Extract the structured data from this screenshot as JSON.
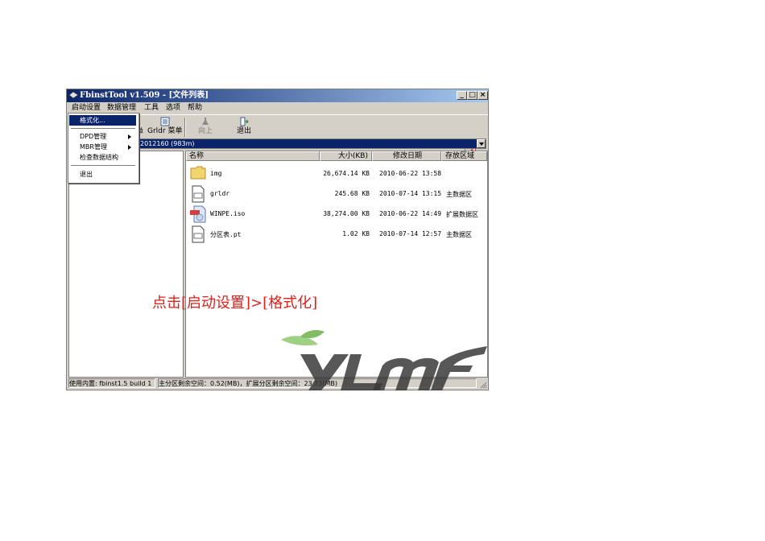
{
  "window": {
    "title": "FbinstTool v1.509 - [文件列表]",
    "controls": {
      "minimize": "_",
      "maximize": "□",
      "close": "×"
    }
  },
  "menubar": [
    "启动设置",
    "数据管理",
    "工具",
    "选项",
    "帮助"
  ],
  "toolbar": {
    "partial_label": "单",
    "grldr_menu": "Grldr 菜单",
    "up": "向上",
    "exit": "退出",
    "step_marker": "②"
  },
  "drive_selector": {
    "value": "2012160 (983m)"
  },
  "dropdown_menu": {
    "items": [
      {
        "label": "格式化...",
        "selected": true
      },
      {
        "label": "DPD管理",
        "submenu": true
      },
      {
        "label": "MBR管理",
        "submenu": true
      },
      {
        "label": "检查数据结构"
      },
      {
        "label": "退出"
      }
    ]
  },
  "file_list": {
    "columns": [
      "名称",
      "大小(KB)",
      "修改日期",
      "存放区域"
    ],
    "rows": [
      {
        "icon": "folder-icon",
        "name": "img",
        "size": "26,674.14 KB",
        "date": "2010-06-22 13:58",
        "area": ""
      },
      {
        "icon": "file-icon",
        "name": "grldr",
        "size": "245.68 KB",
        "date": "2010-07-14 13:15",
        "area": "主数据区"
      },
      {
        "icon": "iso-icon",
        "name": "WINPE.iso",
        "size": "38,274.00 KB",
        "date": "2010-06-22 14:49",
        "area": "扩展数据区"
      },
      {
        "icon": "file-icon",
        "name": "分区表.pt",
        "size": "1.02 KB",
        "date": "2010-07-14 12:57",
        "area": "主数据区"
      }
    ]
  },
  "statusbar": {
    "left": "使用内置: fbinst1.5 build 1",
    "right": "主分区剩余空间：0.52(MB)，扩展分区剩余空间：23.73(MB)"
  },
  "instruction": "点击[启动设置]>[格式化]",
  "colors": {
    "accent": "#0a246a",
    "annotation": "#e0201a",
    "watermark_green": "#5a9a3c"
  }
}
